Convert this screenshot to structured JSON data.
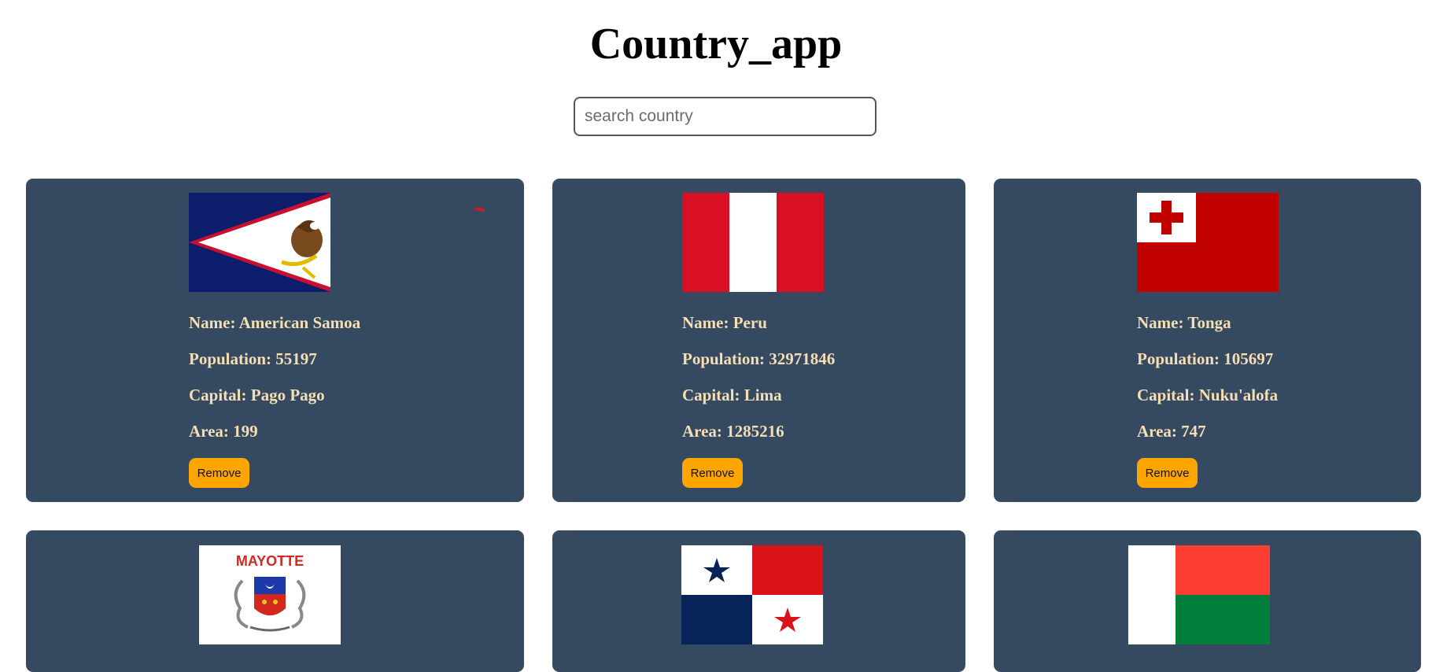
{
  "app": {
    "title": "Country_app"
  },
  "search": {
    "placeholder": "search country",
    "value": ""
  },
  "countries": [
    {
      "name": "American Samoa",
      "population": 55197,
      "capital": "Pago Pago",
      "area": 199
    },
    {
      "name": "Peru",
      "population": 32971846,
      "capital": "Lima",
      "area": 1285216
    },
    {
      "name": "Tonga",
      "population": 105697,
      "capital": "Nuku'alofa",
      "area": 747
    },
    {
      "flag_text": "MAYOTTE"
    },
    {},
    {}
  ],
  "labels": {
    "name": "Name:",
    "population": "Population:",
    "capital": "Capital:",
    "area": "Area:",
    "remove": "Remove"
  },
  "colors": {
    "card_bg": "#354a61",
    "card_text": "#f5deb3",
    "button_bg": "#ffa500"
  }
}
